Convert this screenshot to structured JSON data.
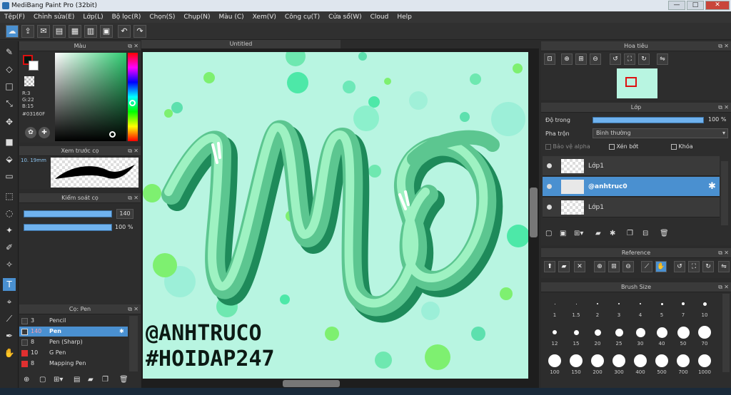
{
  "window": {
    "title": "MediBang Paint Pro (32bit)",
    "minimize": "—",
    "maximize": "□",
    "close": "✕"
  },
  "menu": [
    "Tệp(F)",
    "Chỉnh sửa(E)",
    "Lớp(L)",
    "Bộ lọc(R)",
    "Chọn(S)",
    "Chụp(N)",
    "Màu (C)",
    "Xem(V)",
    "Công cụ(T)",
    "Cửa sổ(W)",
    "Cloud",
    "Help"
  ],
  "color_panel": {
    "title": "Màu",
    "r": "R:3",
    "g": "G:22",
    "b": "B:15",
    "hex": "#03160F",
    "primary": "#03160F",
    "secondary": "#ffffff"
  },
  "brush_preview": {
    "title": "Xem trước cọ",
    "size": "10. 19mm"
  },
  "brush_control": {
    "title": "Kiểm soát cọ",
    "size_value": "140",
    "opacity_value": "100 %"
  },
  "brush_list": {
    "title": "Cọ: Pen",
    "items": [
      {
        "size": "3",
        "name": "Pencil",
        "color": "#3a3a3a",
        "selected": false
      },
      {
        "size": "140",
        "name": "Pen",
        "color": "#3a3a3a",
        "selected": true
      },
      {
        "size": "8",
        "name": "Pen (Sharp)",
        "color": "#3a3a3a",
        "selected": false
      },
      {
        "size": "10",
        "name": "G Pen",
        "color": "#e03030",
        "selected": false
      },
      {
        "size": "8",
        "name": "Mapping Pen",
        "color": "#e03030",
        "selected": false
      }
    ]
  },
  "document": {
    "tab": "Untitled",
    "watermark_1": "@ANHTRUCO",
    "watermark_2": "#HOIDAP247",
    "artwork_text": "mơ"
  },
  "navigator": {
    "title": "Hoa tiêu"
  },
  "layers": {
    "title": "Lớp",
    "opacity_label": "Độ trong",
    "opacity_value": "100 %",
    "blend_label": "Pha trộn",
    "blend_value": "Bình thường",
    "protect_alpha": "Bảo vệ alpha",
    "clipping": "Xén bớt",
    "lock": "Khóa",
    "items": [
      {
        "name": "Lớp1",
        "selected": false
      },
      {
        "name": "@anhtruc0",
        "selected": true
      },
      {
        "name": "Lớp1",
        "selected": false
      }
    ]
  },
  "reference": {
    "title": "Reference"
  },
  "brush_size": {
    "title": "Brush Size",
    "sizes": [
      "1",
      "1.5",
      "2",
      "3",
      "4",
      "5",
      "7",
      "10",
      "12",
      "15",
      "20",
      "25",
      "30",
      "40",
      "50",
      "70",
      "100",
      "150",
      "200",
      "300",
      "400",
      "500",
      "700",
      "1000"
    ]
  },
  "colors": {
    "accent": "#4a90d0",
    "canvas_bg": "#b8f5e1"
  }
}
